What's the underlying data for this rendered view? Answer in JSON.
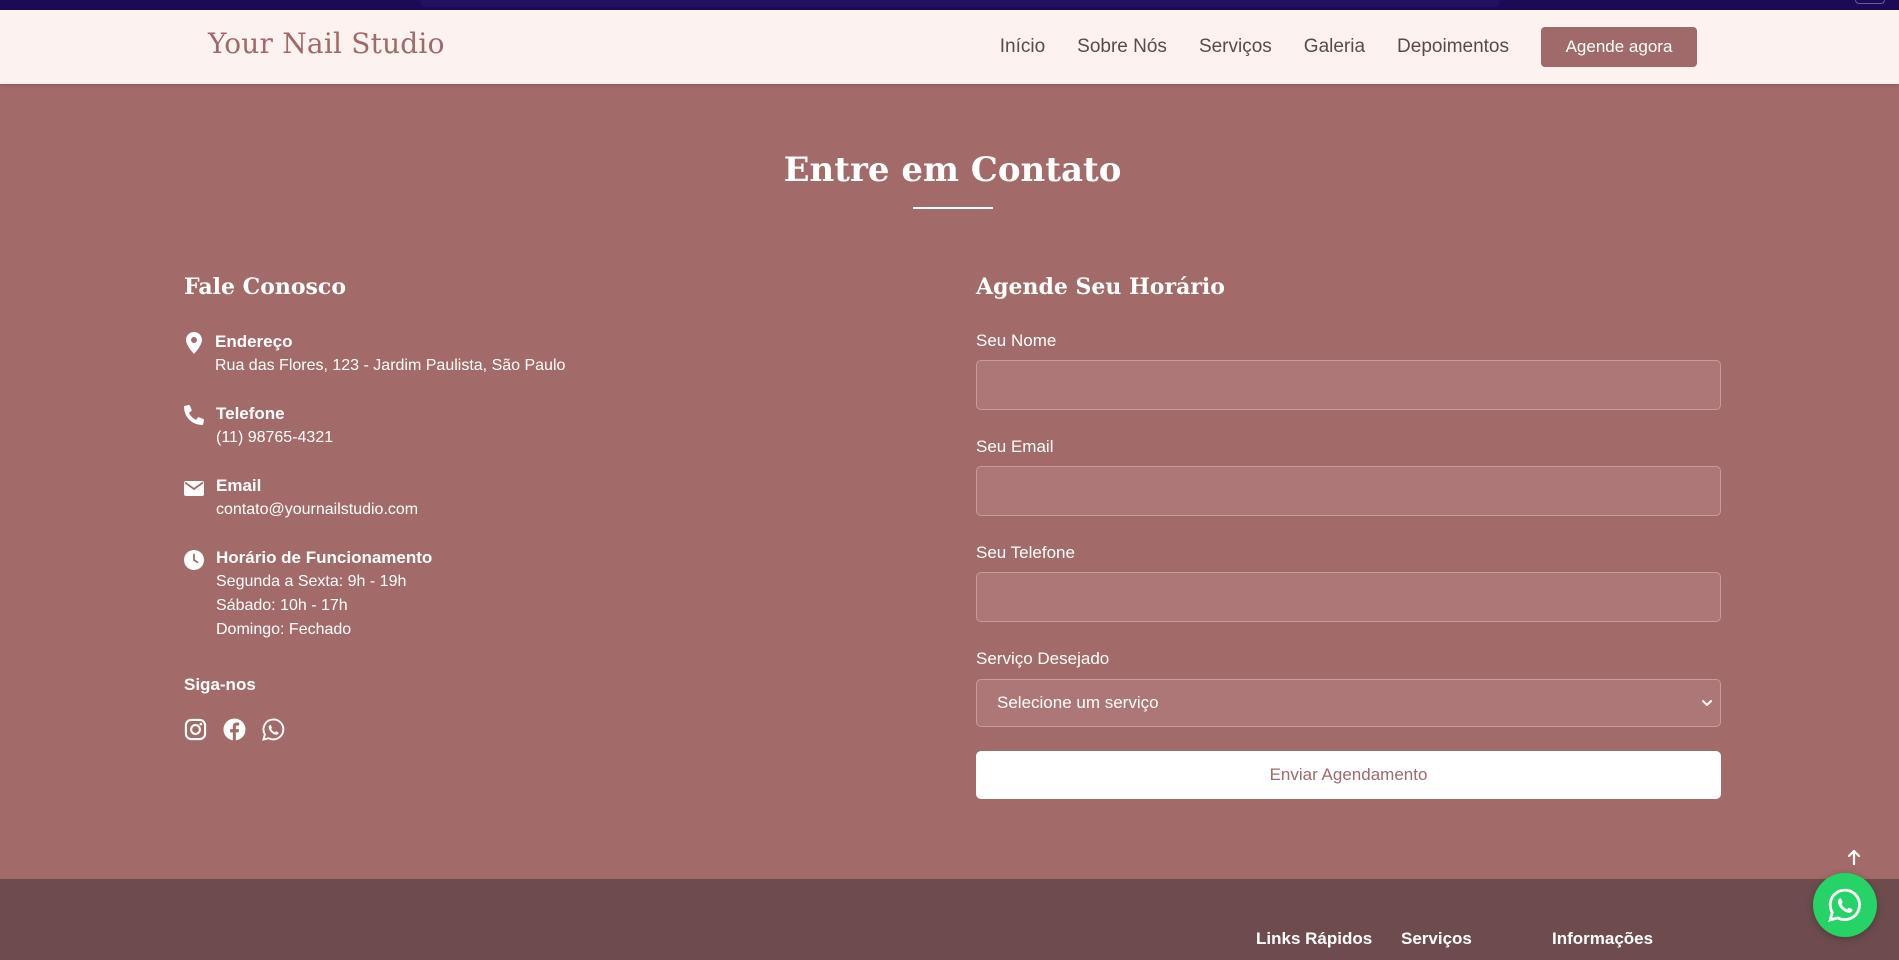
{
  "brand": {
    "name": "Your Nail Studio"
  },
  "nav": {
    "items": [
      {
        "label": "Início"
      },
      {
        "label": "Sobre Nós"
      },
      {
        "label": "Serviços"
      },
      {
        "label": "Galeria"
      },
      {
        "label": "Depoimentos"
      }
    ],
    "cta_label": "Agende agora"
  },
  "contact_section": {
    "title": "Entre em Contato",
    "info": {
      "heading": "Fale Conosco",
      "address": {
        "label": "Endereço",
        "value": "Rua das Flores, 123 - Jardim Paulista, São Paulo",
        "icon": "map-pin-icon"
      },
      "phone": {
        "label": "Telefone",
        "value": "(11) 98765-4321",
        "icon": "phone-icon"
      },
      "email": {
        "label": "Email",
        "value": "contato@yournailstudio.com",
        "icon": "envelope-icon"
      },
      "hours": {
        "label": "Horário de Funcionamento",
        "lines": [
          "Segunda a Sexta: 9h - 19h",
          "Sábado: 10h - 17h",
          "Domingo: Fechado"
        ],
        "icon": "clock-icon"
      },
      "follow_label": "Siga-nos",
      "socials": [
        "instagram-icon",
        "facebook-icon",
        "whatsapp-icon"
      ]
    },
    "form": {
      "heading": "Agende Seu Horário",
      "name_label": "Seu Nome",
      "name_value": "",
      "email_label": "Seu Email",
      "email_value": "",
      "phone_label": "Seu Telefone",
      "phone_value": "",
      "service_label": "Serviço Desejado",
      "service_selected": "Selecione um serviço",
      "submit_label": "Enviar Agendamento"
    }
  },
  "footer": {
    "headings": [
      "Links Rápidos",
      "Serviços",
      "Informações"
    ]
  },
  "colors": {
    "section_bg": "#a26a68",
    "navbar_bg": "#fcf3f1",
    "accent": "#a06a6a",
    "footer_bg": "#6e4c4e",
    "whatsapp": "#25d366"
  }
}
